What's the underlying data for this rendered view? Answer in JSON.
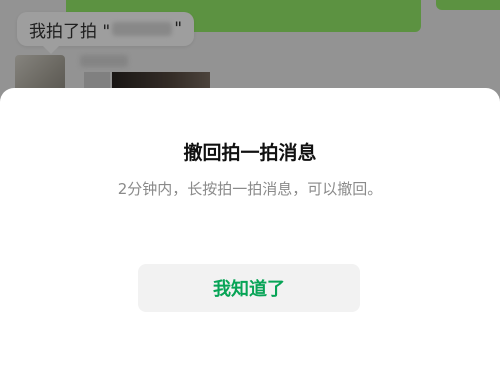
{
  "chat": {
    "pat_text_prefix": "我拍了拍 \"",
    "pat_text_suffix": "\""
  },
  "sheet": {
    "title": "撤回拍一拍消息",
    "description": "2分钟内，长按拍一拍消息，可以撤回。",
    "confirm_label": "我知道了"
  },
  "colors": {
    "accent_green": "#07a456",
    "bubble_green": "#95ec69"
  }
}
